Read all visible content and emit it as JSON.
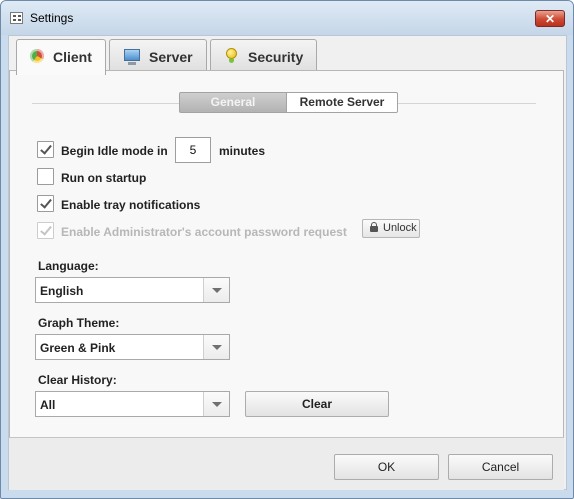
{
  "window": {
    "title": "Settings",
    "close_symbol": "✕"
  },
  "tabs": [
    {
      "label": "Client",
      "icon": "client-icon",
      "active": true
    },
    {
      "label": "Server",
      "icon": "monitor-icon",
      "active": false
    },
    {
      "label": "Security",
      "icon": "security-icon",
      "active": false
    }
  ],
  "subtabs": [
    {
      "label": "General",
      "selected": true
    },
    {
      "label": "Remote Server",
      "selected": false
    }
  ],
  "options": {
    "idle": {
      "label_before": "Begin Idle mode in",
      "value": "5",
      "label_after": "minutes",
      "checked": true
    },
    "startup": {
      "label": "Run on startup",
      "checked": false
    },
    "tray": {
      "label": "Enable tray notifications",
      "checked": true
    },
    "admin": {
      "label": "Enable Administrator's account password request",
      "checked": true,
      "disabled": true
    },
    "unlock_label": "Unlock"
  },
  "language": {
    "label": "Language:",
    "value": "English"
  },
  "graph_theme": {
    "label": "Graph Theme:",
    "value": "Green & Pink"
  },
  "clear_history": {
    "label": "Clear History:",
    "value": "All",
    "button": "Clear"
  },
  "footer": {
    "ok": "OK",
    "cancel": "Cancel"
  }
}
